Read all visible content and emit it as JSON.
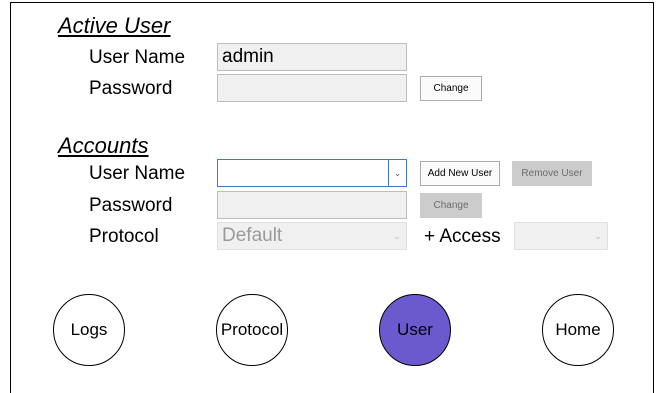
{
  "active_user": {
    "title": "Active User",
    "username_label": "User Name",
    "username_value": "admin",
    "password_label": "Password",
    "password_value": "",
    "change_button": "Change"
  },
  "accounts": {
    "title": "Accounts",
    "username_label": "User Name",
    "username_value": "",
    "add_button": "Add New User",
    "remove_button": "Remove User",
    "password_label": "Password",
    "password_value": "",
    "change_button": "Change",
    "protocol_label": "Protocol",
    "protocol_value": "Default",
    "access_label": "+ Access",
    "access_value": ""
  },
  "nav": {
    "logs": "Logs",
    "protocol": "Protocol",
    "user": "User",
    "home": "Home",
    "active_item": "User"
  },
  "colors": {
    "nav_active": "#6a5acd",
    "combo_focus_border": "#3d7bd0",
    "disabled_button_bg": "#cccccc",
    "field_bg": "#f0f0f0"
  },
  "icons": {
    "dropdown": "chevron-down-icon"
  }
}
